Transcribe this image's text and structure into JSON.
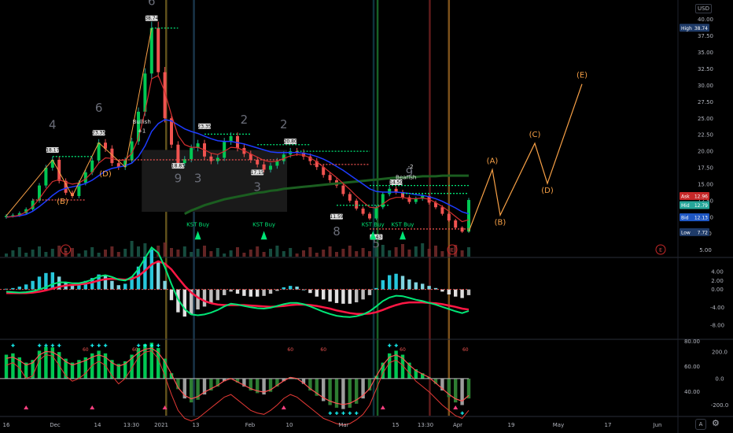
{
  "currency": "USD",
  "chart_data": [
    {
      "type": "line",
      "pane": "price",
      "ylim": [
        4,
        42
      ],
      "y_ticks": [
        "40.00",
        "37.50",
        "35.00",
        "32.50",
        "30.00",
        "27.50",
        "25.00",
        "22.50",
        "20.00",
        "17.50",
        "15.00",
        "12.50",
        "10.00",
        "7.50",
        "5.00"
      ],
      "y_tick_values": [
        40,
        37.5,
        35,
        32.5,
        30,
        27.5,
        25,
        22.5,
        20,
        17.5,
        15,
        12.5,
        10,
        7.5,
        5
      ],
      "x_ticks": [
        "16",
        "Dec",
        "14",
        "13:30",
        "2021",
        "13",
        "Feb",
        "10",
        "Mar",
        "15",
        "13:30",
        "Apr",
        "19",
        "May",
        "17",
        "Jun"
      ],
      "series": [
        {
          "values": [
            10.2,
            10.3,
            10.6,
            11.2,
            12.5,
            14.8,
            17.5,
            18.7,
            15.5,
            13.7,
            13.2,
            15.2,
            16.8,
            18.6,
            21.3,
            20.4,
            18.2,
            17.6,
            18.6,
            21.5,
            26.0,
            31.8,
            38.7,
            32.0,
            25.0,
            21.0,
            18.2,
            18.8,
            20.5,
            21.2,
            19.2,
            18.5,
            19.0,
            21.5,
            22.3,
            20.5,
            19.6,
            18.7,
            18.0,
            17.2,
            17.8,
            18.5,
            19.5,
            20.0,
            19.8,
            19.2,
            18.5,
            17.6,
            16.4,
            15.6,
            14.8,
            13.5,
            12.5,
            11.3,
            10.5,
            9.8,
            11.5,
            13.5,
            14.3,
            13.8,
            13.0,
            12.3,
            12.8,
            13.2,
            12.2,
            11.5,
            10.5,
            9.5,
            8.4,
            7.8,
            12.6
          ]
        },
        {
          "values": [
            10.0,
            10.1,
            10.3,
            10.8,
            11.6,
            12.8,
            14.2,
            15.4,
            15.7,
            15.3,
            15.0,
            15.2,
            15.8,
            16.8,
            18.2,
            19.0,
            18.9,
            18.6,
            18.7,
            19.7,
            22.0,
            26.0,
            31.0,
            31.5,
            29.0,
            25.5,
            22.4,
            21.0,
            20.6,
            20.6,
            20.2,
            19.7,
            19.5,
            20.0,
            20.6,
            20.5,
            20.1,
            19.6,
            19.1,
            18.6,
            18.4,
            18.5,
            18.9,
            19.3,
            19.5,
            19.4,
            19.0,
            18.4,
            17.6,
            16.8,
            16.0,
            15.1,
            14.2,
            13.2,
            12.3,
            11.5,
            11.4,
            12.0,
            12.7,
            13.0,
            13.0,
            12.8,
            12.8,
            12.9,
            12.7,
            12.2,
            11.6,
            10.9,
            10.1,
            9.3,
            9.6
          ]
        },
        {
          "values": [
            10.0,
            10.1,
            10.2,
            10.4,
            10.9,
            11.6,
            12.4,
            13.3,
            14.0,
            14.4,
            14.6,
            14.8,
            15.1,
            15.6,
            16.3,
            17.0,
            17.4,
            17.6,
            17.8,
            18.2,
            19.2,
            20.8,
            23.0,
            24.2,
            24.8,
            24.6,
            24.0,
            23.4,
            23.0,
            22.7,
            22.3,
            21.9,
            21.6,
            21.5,
            21.5,
            21.3,
            21.1,
            20.8,
            20.5,
            20.2,
            19.9,
            19.8,
            19.8,
            19.8,
            19.8,
            19.7,
            19.5,
            19.2,
            18.8,
            18.3,
            17.7,
            17.1,
            16.4,
            15.7,
            15.0,
            14.3,
            13.9,
            13.8,
            13.8,
            13.8,
            13.7,
            13.6,
            13.4,
            13.3,
            13.1,
            12.8,
            12.4,
            11.9,
            11.4,
            10.8,
            10.5
          ]
        },
        {
          "values": [
            null,
            null,
            null,
            null,
            null,
            null,
            null,
            null,
            null,
            null,
            null,
            null,
            null,
            null,
            null,
            null,
            null,
            null,
            null,
            null,
            null,
            null,
            null,
            null,
            null,
            null,
            null,
            10.5,
            11.0,
            11.4,
            11.8,
            12.1,
            12.4,
            12.7,
            12.9,
            13.1,
            13.3,
            13.5,
            13.7,
            13.8,
            14.0,
            14.1,
            14.3,
            14.4,
            14.5,
            14.6,
            14.7,
            14.8,
            14.9,
            15.0,
            15.1,
            15.2,
            15.3,
            15.4,
            15.5,
            15.6,
            15.7,
            15.8,
            15.9,
            16.0,
            16.0,
            16.1,
            16.1,
            16.2,
            16.2,
            16.2,
            16.3,
            16.3,
            16.3,
            16.3,
            16.3
          ]
        }
      ],
      "projection": {
        "labels": [
          "(A)",
          "(B)",
          "(C)",
          "(D)",
          "(E)"
        ],
        "values": [
          7.8,
          17.2,
          10.3,
          21.2,
          15.1,
          30.2
        ]
      },
      "price_labels": [
        "18.17",
        "23.35",
        "38.74",
        "18.83",
        "23.35",
        "17.15",
        "20.80",
        "11.59",
        "14.50",
        "8.43"
      ],
      "annotations": {
        "bullish": "Bullish",
        "bullish_count": "+1",
        "bearish": "Bearish",
        "bearish_count": "-2",
        "kst_buy": "KST Buy",
        "earnings": "E",
        "counts": [
          "4",
          "6",
          "6",
          "9",
          "3",
          "2",
          "3",
          "2",
          "8",
          "5",
          "9"
        ]
      },
      "side_labels": {
        "high": "High",
        "high_value": "38.74",
        "ask": "Ask",
        "ask_value": "12.96",
        "mid": "Mid",
        "mid_value": "12.79",
        "bid": "Bid",
        "bid_value": "12.13",
        "low": "Low",
        "low_value": "7.72"
      },
      "colors": {
        "up": "#26a69a",
        "down": "#ef5350",
        "blue": "#1e3cff",
        "green_ma": "#1b5e20",
        "orange": "#f7a046"
      }
    },
    {
      "type": "bar",
      "pane": "macd",
      "ylim": [
        -11,
        7
      ],
      "y_ticks": [
        "4.00",
        "2.00",
        "0.00",
        "-4.00",
        "-8.00"
      ],
      "y_tick_values": [
        4,
        2,
        0,
        -4,
        -8
      ],
      "series": [
        {
          "values": [
            0.1,
            0.2,
            0.4,
            0.7,
            1.2,
            1.8,
            2.3,
            2.4,
            1.8,
            1.0,
            0.6,
            0.8,
            1.2,
            1.6,
            2.1,
            1.9,
            1.2,
            0.6,
            0.8,
            1.8,
            3.2,
            4.6,
            5.6,
            4.0,
            1.2,
            -1.5,
            -3.2,
            -3.8,
            -3.5,
            -2.8,
            -2.4,
            -2.0,
            -1.5,
            -0.8,
            -0.3,
            -0.6,
            -0.9,
            -1.0,
            -1.0,
            -0.9,
            -0.6,
            -0.2,
            0.3,
            0.5,
            0.4,
            0.0,
            -0.5,
            -1.0,
            -1.4,
            -1.7,
            -1.9,
            -2.0,
            -2.0,
            -1.8,
            -1.4,
            -0.8,
            0.2,
            1.3,
            2.0,
            2.2,
            1.9,
            1.4,
            1.0,
            0.8,
            0.5,
            0.2,
            -0.3,
            -0.7,
            -1.0,
            -1.2,
            -0.8
          ]
        },
        {
          "values": [
            -0.5,
            -0.6,
            -0.7,
            -0.6,
            -0.4,
            0.0,
            0.5,
            1.2,
            1.6,
            1.6,
            1.4,
            1.4,
            1.7,
            2.2,
            2.9,
            3.2,
            2.8,
            2.2,
            2.0,
            2.8,
            4.6,
            7.0,
            9.4,
            8.2,
            5.0,
            1.2,
            -2.2,
            -4.4,
            -5.6,
            -5.8,
            -5.6,
            -5.2,
            -4.6,
            -3.8,
            -3.2,
            -3.4,
            -3.7,
            -4.0,
            -4.2,
            -4.3,
            -4.1,
            -3.7,
            -3.3,
            -3.0,
            -3.0,
            -3.3,
            -3.8,
            -4.4,
            -5.0,
            -5.5,
            -5.9,
            -6.1,
            -6.2,
            -6.0,
            -5.6,
            -4.9,
            -3.8,
            -2.6,
            -1.8,
            -1.4,
            -1.5,
            -1.9,
            -2.3,
            -2.6,
            -3.0,
            -3.4,
            -3.9,
            -4.4,
            -4.9,
            -5.3,
            -4.8
          ]
        },
        {
          "values": [
            -0.8,
            -0.8,
            -0.8,
            -0.8,
            -0.7,
            -0.5,
            -0.2,
            0.2,
            0.6,
            0.9,
            1.0,
            1.1,
            1.3,
            1.6,
            2.0,
            2.3,
            2.4,
            2.3,
            2.2,
            2.4,
            3.0,
            4.2,
            5.6,
            6.3,
            5.8,
            4.5,
            2.6,
            0.8,
            -0.7,
            -1.8,
            -2.6,
            -3.1,
            -3.4,
            -3.5,
            -3.5,
            -3.5,
            -3.5,
            -3.6,
            -3.7,
            -3.8,
            -3.9,
            -3.8,
            -3.7,
            -3.5,
            -3.4,
            -3.4,
            -3.5,
            -3.7,
            -4.0,
            -4.3,
            -4.7,
            -5.0,
            -5.3,
            -5.5,
            -5.5,
            -5.4,
            -5.1,
            -4.6,
            -4.0,
            -3.5,
            -3.1,
            -2.9,
            -2.9,
            -2.9,
            -3.0,
            -3.1,
            -3.3,
            -3.6,
            -3.9,
            -4.3,
            -4.5
          ]
        }
      ]
    },
    {
      "type": "bar",
      "pane": "oscillator",
      "ylim": [
        -280,
        290
      ],
      "y_ticks": [
        "80.00",
        "60.00",
        "40.00"
      ],
      "y_tick_values": [
        80,
        60,
        40
      ],
      "y_ticks_right": [
        "200.0",
        "0.0",
        "-200.0"
      ],
      "y_tick_values_right": [
        200,
        0,
        -200
      ],
      "labels": [
        "60",
        "5",
        "9"
      ],
      "series": [
        {
          "values": [
            180,
            190,
            160,
            120,
            140,
            210,
            240,
            235,
            200,
            150,
            120,
            140,
            160,
            190,
            210,
            190,
            140,
            110,
            130,
            180,
            230,
            260,
            270,
            230,
            150,
            40,
            -80,
            -150,
            -180,
            -160,
            -120,
            -90,
            -60,
            -20,
            0,
            -30,
            -60,
            -90,
            -110,
            -120,
            -100,
            -60,
            -20,
            10,
            0,
            -40,
            -90,
            -130,
            -170,
            -200,
            -220,
            -230,
            -220,
            -190,
            -150,
            -90,
            20,
            120,
            190,
            210,
            180,
            120,
            70,
            40,
            10,
            -40,
            -90,
            -140,
            -180,
            -200,
            -150
          ]
        },
        {
          "values": [
            70,
            72,
            68,
            60,
            62,
            74,
            78,
            77,
            70,
            62,
            58,
            60,
            64,
            70,
            73,
            70,
            62,
            56,
            60,
            68,
            76,
            80,
            81,
            75,
            62,
            48,
            36,
            30,
            28,
            30,
            34,
            38,
            42,
            46,
            48,
            44,
            40,
            36,
            34,
            33,
            36,
            40,
            45,
            48,
            46,
            42,
            38,
            34,
            30,
            28,
            26,
            25,
            26,
            29,
            33,
            40,
            52,
            64,
            72,
            74,
            70,
            64,
            58,
            54,
            50,
            45,
            40,
            36,
            32,
            30,
            36
          ]
        }
      ]
    }
  ]
}
